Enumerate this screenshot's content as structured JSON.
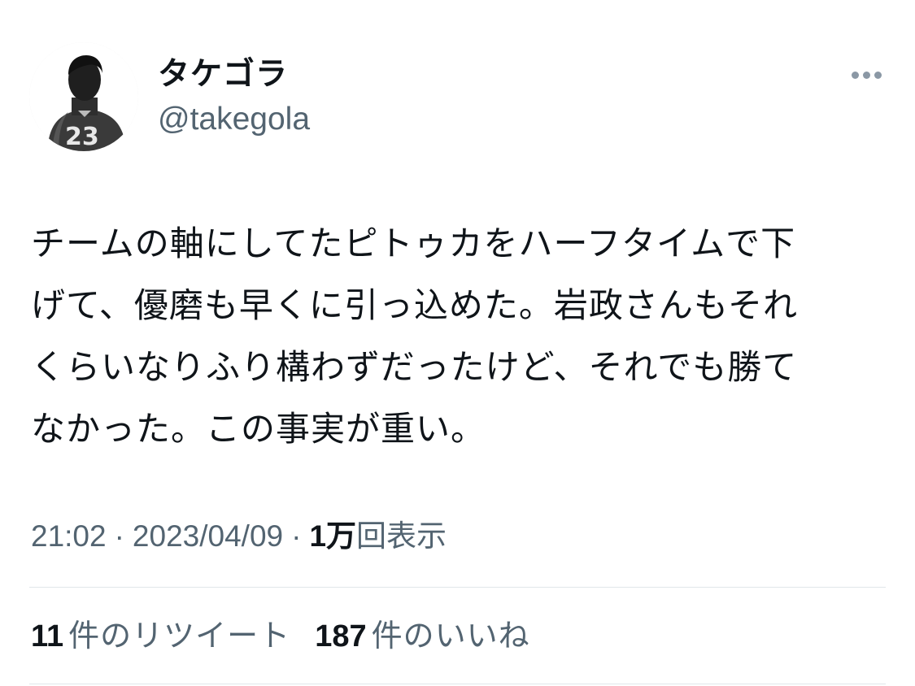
{
  "user": {
    "display_name": "タケゴラ",
    "handle": "@takegola",
    "avatar_icon": "player-photo-avatar"
  },
  "menu": {
    "more_icon": "more-horizontal-icon"
  },
  "tweet": {
    "text": "チームの軸にしてたピトゥカをハーフタイムで下\nげて、優磨も早くに引っ込めた。岩政さんもそれ\nくらいなりふり構わずだったけど、それでも勝て\nなかった。この事実が重い。"
  },
  "meta": {
    "time": "21:02",
    "separator": "·",
    "date": "2023/04/09",
    "views_count": "1万",
    "views_label": "回表示"
  },
  "stats": {
    "retweets_count": "11",
    "retweets_label": "件のリツイート",
    "likes_count": "187",
    "likes_label": "件のいいね"
  },
  "colors": {
    "text_primary": "#0f1419",
    "text_secondary": "#536471",
    "divider": "#e1e6ea"
  }
}
